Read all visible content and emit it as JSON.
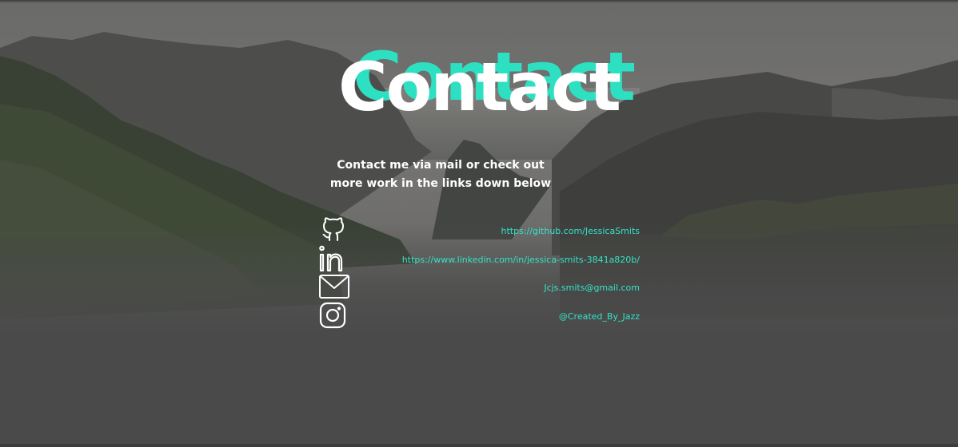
{
  "header": {
    "title": "Contact",
    "subtitle_line1": "Contact me via mail or check out",
    "subtitle_line2": "more work in the links down below"
  },
  "contacts": [
    {
      "icon": "github-icon",
      "text": "https://github.com/JessicaSmits"
    },
    {
      "icon": "linkedin-icon",
      "text": "https://www.linkedin.com/in/jessica-smits-3841a820b/"
    },
    {
      "icon": "mail-icon",
      "text": "Jcjs.smits@gmail.com"
    },
    {
      "icon": "instagram-icon",
      "text": "@Created_By_Jazz"
    }
  ],
  "colors": {
    "accent": "#34e3c7",
    "title_shadow": "#2ee0c2",
    "background": "#4a4a4a",
    "text": "#ffffff"
  }
}
